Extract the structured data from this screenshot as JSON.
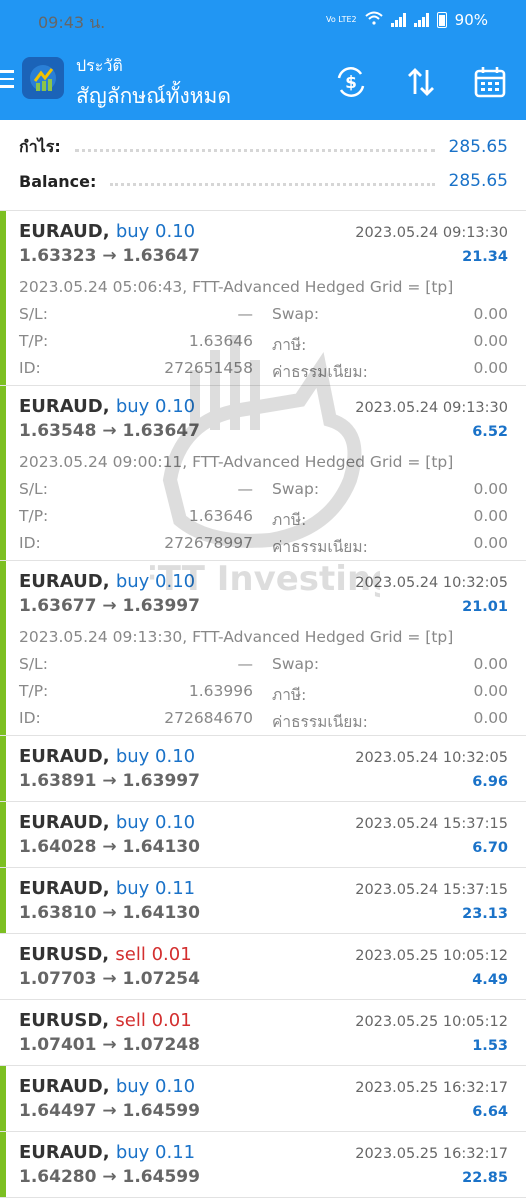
{
  "status_bar": {
    "time": "09:43 น.",
    "indicators": "Vo LTE2",
    "battery": "90%"
  },
  "app_bar": {
    "title": "ประวัติ",
    "subtitle": "สัญลักษณ์ทั้งหมด"
  },
  "summary": {
    "profit_label": "กำไร:",
    "profit_value": "285.65",
    "balance_label": "Balance:",
    "balance_value": "285.65"
  },
  "labels": {
    "sl": "S/L:",
    "tp": "T/P:",
    "id": "ID:",
    "swap": "Swap:",
    "tax": "ภาษี:",
    "fee": "ค่าธรรมเนียม:"
  },
  "watermark": "FTT Investing",
  "deals": [
    {
      "symbol": "EURAUD,",
      "side": "buy",
      "volume": "buy 0.10",
      "prices": "1.63323 → 1.63647",
      "time": "2023.05.24 09:13:30",
      "profit": "21.34",
      "comment": "2023.05.24 05:06:43, FTT-Advanced Hedged Grid = [tp]",
      "sl": "—",
      "tp": "1.63646",
      "id": "272651458",
      "swap": "0.00",
      "tax": "0.00",
      "fee": "0.00"
    },
    {
      "symbol": "EURAUD,",
      "side": "buy",
      "volume": "buy 0.10",
      "prices": "1.63548 → 1.63647",
      "time": "2023.05.24 09:13:30",
      "profit": "6.52",
      "comment": "2023.05.24 09:00:11, FTT-Advanced Hedged Grid = [tp]",
      "sl": "—",
      "tp": "1.63646",
      "id": "272678997",
      "swap": "0.00",
      "tax": "0.00",
      "fee": "0.00"
    },
    {
      "symbol": "EURAUD,",
      "side": "buy",
      "volume": "buy 0.10",
      "prices": "1.63677 → 1.63997",
      "time": "2023.05.24 10:32:05",
      "profit": "21.01",
      "comment": "2023.05.24 09:13:30, FTT-Advanced Hedged Grid = [tp]",
      "sl": "—",
      "tp": "1.63996",
      "id": "272684670",
      "swap": "0.00",
      "tax": "0.00",
      "fee": "0.00"
    },
    {
      "symbol": "EURAUD,",
      "side": "buy",
      "volume": "buy 0.10",
      "prices": "1.63891 → 1.63997",
      "time": "2023.05.24 10:32:05",
      "profit": "6.96"
    },
    {
      "symbol": "EURAUD,",
      "side": "buy",
      "volume": "buy 0.10",
      "prices": "1.64028 → 1.64130",
      "time": "2023.05.24 15:37:15",
      "profit": "6.70"
    },
    {
      "symbol": "EURAUD,",
      "side": "buy",
      "volume": "buy 0.11",
      "prices": "1.63810 → 1.64130",
      "time": "2023.05.24 15:37:15",
      "profit": "23.13"
    },
    {
      "symbol": "EURUSD,",
      "side": "sell",
      "volume": "sell 0.01",
      "prices": "1.07703 → 1.07254",
      "time": "2023.05.25 10:05:12",
      "profit": "4.49"
    },
    {
      "symbol": "EURUSD,",
      "side": "sell",
      "volume": "sell 0.01",
      "prices": "1.07401 → 1.07248",
      "time": "2023.05.25 10:05:12",
      "profit": "1.53"
    },
    {
      "symbol": "EURAUD,",
      "side": "buy",
      "volume": "buy 0.10",
      "prices": "1.64497 → 1.64599",
      "time": "2023.05.25 16:32:17",
      "profit": "6.64"
    },
    {
      "symbol": "EURAUD,",
      "side": "buy",
      "volume": "buy 0.11",
      "prices": "1.64280 → 1.64599",
      "time": "2023.05.25 16:32:17",
      "profit": "22.85"
    }
  ]
}
